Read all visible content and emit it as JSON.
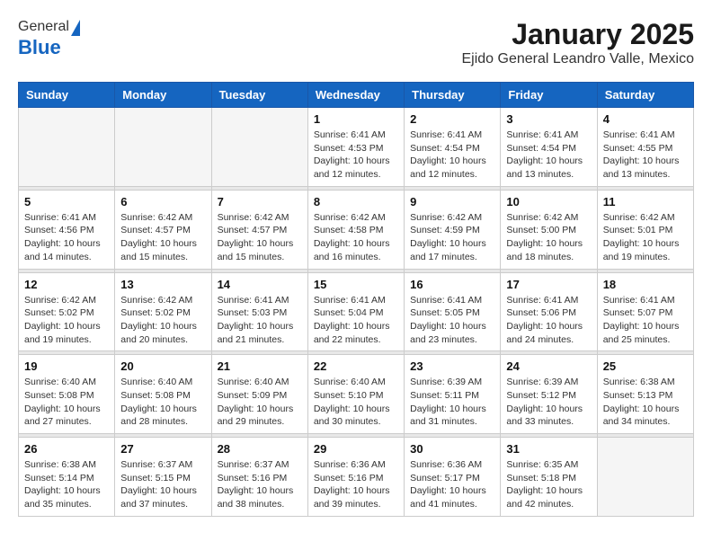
{
  "header": {
    "logo_general": "General",
    "logo_blue": "Blue",
    "title": "January 2025",
    "subtitle": "Ejido General Leandro Valle, Mexico"
  },
  "weekdays": [
    "Sunday",
    "Monday",
    "Tuesday",
    "Wednesday",
    "Thursday",
    "Friday",
    "Saturday"
  ],
  "weeks": [
    [
      {
        "day": "",
        "sunrise": "",
        "sunset": "",
        "daylight": ""
      },
      {
        "day": "",
        "sunrise": "",
        "sunset": "",
        "daylight": ""
      },
      {
        "day": "",
        "sunrise": "",
        "sunset": "",
        "daylight": ""
      },
      {
        "day": "1",
        "sunrise": "Sunrise: 6:41 AM",
        "sunset": "Sunset: 4:53 PM",
        "daylight": "Daylight: 10 hours and 12 minutes."
      },
      {
        "day": "2",
        "sunrise": "Sunrise: 6:41 AM",
        "sunset": "Sunset: 4:54 PM",
        "daylight": "Daylight: 10 hours and 12 minutes."
      },
      {
        "day": "3",
        "sunrise": "Sunrise: 6:41 AM",
        "sunset": "Sunset: 4:54 PM",
        "daylight": "Daylight: 10 hours and 13 minutes."
      },
      {
        "day": "4",
        "sunrise": "Sunrise: 6:41 AM",
        "sunset": "Sunset: 4:55 PM",
        "daylight": "Daylight: 10 hours and 13 minutes."
      }
    ],
    [
      {
        "day": "5",
        "sunrise": "Sunrise: 6:41 AM",
        "sunset": "Sunset: 4:56 PM",
        "daylight": "Daylight: 10 hours and 14 minutes."
      },
      {
        "day": "6",
        "sunrise": "Sunrise: 6:42 AM",
        "sunset": "Sunset: 4:57 PM",
        "daylight": "Daylight: 10 hours and 15 minutes."
      },
      {
        "day": "7",
        "sunrise": "Sunrise: 6:42 AM",
        "sunset": "Sunset: 4:57 PM",
        "daylight": "Daylight: 10 hours and 15 minutes."
      },
      {
        "day": "8",
        "sunrise": "Sunrise: 6:42 AM",
        "sunset": "Sunset: 4:58 PM",
        "daylight": "Daylight: 10 hours and 16 minutes."
      },
      {
        "day": "9",
        "sunrise": "Sunrise: 6:42 AM",
        "sunset": "Sunset: 4:59 PM",
        "daylight": "Daylight: 10 hours and 17 minutes."
      },
      {
        "day": "10",
        "sunrise": "Sunrise: 6:42 AM",
        "sunset": "Sunset: 5:00 PM",
        "daylight": "Daylight: 10 hours and 18 minutes."
      },
      {
        "day": "11",
        "sunrise": "Sunrise: 6:42 AM",
        "sunset": "Sunset: 5:01 PM",
        "daylight": "Daylight: 10 hours and 19 minutes."
      }
    ],
    [
      {
        "day": "12",
        "sunrise": "Sunrise: 6:42 AM",
        "sunset": "Sunset: 5:02 PM",
        "daylight": "Daylight: 10 hours and 19 minutes."
      },
      {
        "day": "13",
        "sunrise": "Sunrise: 6:42 AM",
        "sunset": "Sunset: 5:02 PM",
        "daylight": "Daylight: 10 hours and 20 minutes."
      },
      {
        "day": "14",
        "sunrise": "Sunrise: 6:41 AM",
        "sunset": "Sunset: 5:03 PM",
        "daylight": "Daylight: 10 hours and 21 minutes."
      },
      {
        "day": "15",
        "sunrise": "Sunrise: 6:41 AM",
        "sunset": "Sunset: 5:04 PM",
        "daylight": "Daylight: 10 hours and 22 minutes."
      },
      {
        "day": "16",
        "sunrise": "Sunrise: 6:41 AM",
        "sunset": "Sunset: 5:05 PM",
        "daylight": "Daylight: 10 hours and 23 minutes."
      },
      {
        "day": "17",
        "sunrise": "Sunrise: 6:41 AM",
        "sunset": "Sunset: 5:06 PM",
        "daylight": "Daylight: 10 hours and 24 minutes."
      },
      {
        "day": "18",
        "sunrise": "Sunrise: 6:41 AM",
        "sunset": "Sunset: 5:07 PM",
        "daylight": "Daylight: 10 hours and 25 minutes."
      }
    ],
    [
      {
        "day": "19",
        "sunrise": "Sunrise: 6:40 AM",
        "sunset": "Sunset: 5:08 PM",
        "daylight": "Daylight: 10 hours and 27 minutes."
      },
      {
        "day": "20",
        "sunrise": "Sunrise: 6:40 AM",
        "sunset": "Sunset: 5:08 PM",
        "daylight": "Daylight: 10 hours and 28 minutes."
      },
      {
        "day": "21",
        "sunrise": "Sunrise: 6:40 AM",
        "sunset": "Sunset: 5:09 PM",
        "daylight": "Daylight: 10 hours and 29 minutes."
      },
      {
        "day": "22",
        "sunrise": "Sunrise: 6:40 AM",
        "sunset": "Sunset: 5:10 PM",
        "daylight": "Daylight: 10 hours and 30 minutes."
      },
      {
        "day": "23",
        "sunrise": "Sunrise: 6:39 AM",
        "sunset": "Sunset: 5:11 PM",
        "daylight": "Daylight: 10 hours and 31 minutes."
      },
      {
        "day": "24",
        "sunrise": "Sunrise: 6:39 AM",
        "sunset": "Sunset: 5:12 PM",
        "daylight": "Daylight: 10 hours and 33 minutes."
      },
      {
        "day": "25",
        "sunrise": "Sunrise: 6:38 AM",
        "sunset": "Sunset: 5:13 PM",
        "daylight": "Daylight: 10 hours and 34 minutes."
      }
    ],
    [
      {
        "day": "26",
        "sunrise": "Sunrise: 6:38 AM",
        "sunset": "Sunset: 5:14 PM",
        "daylight": "Daylight: 10 hours and 35 minutes."
      },
      {
        "day": "27",
        "sunrise": "Sunrise: 6:37 AM",
        "sunset": "Sunset: 5:15 PM",
        "daylight": "Daylight: 10 hours and 37 minutes."
      },
      {
        "day": "28",
        "sunrise": "Sunrise: 6:37 AM",
        "sunset": "Sunset: 5:16 PM",
        "daylight": "Daylight: 10 hours and 38 minutes."
      },
      {
        "day": "29",
        "sunrise": "Sunrise: 6:36 AM",
        "sunset": "Sunset: 5:16 PM",
        "daylight": "Daylight: 10 hours and 39 minutes."
      },
      {
        "day": "30",
        "sunrise": "Sunrise: 6:36 AM",
        "sunset": "Sunset: 5:17 PM",
        "daylight": "Daylight: 10 hours and 41 minutes."
      },
      {
        "day": "31",
        "sunrise": "Sunrise: 6:35 AM",
        "sunset": "Sunset: 5:18 PM",
        "daylight": "Daylight: 10 hours and 42 minutes."
      },
      {
        "day": "",
        "sunrise": "",
        "sunset": "",
        "daylight": ""
      }
    ]
  ]
}
